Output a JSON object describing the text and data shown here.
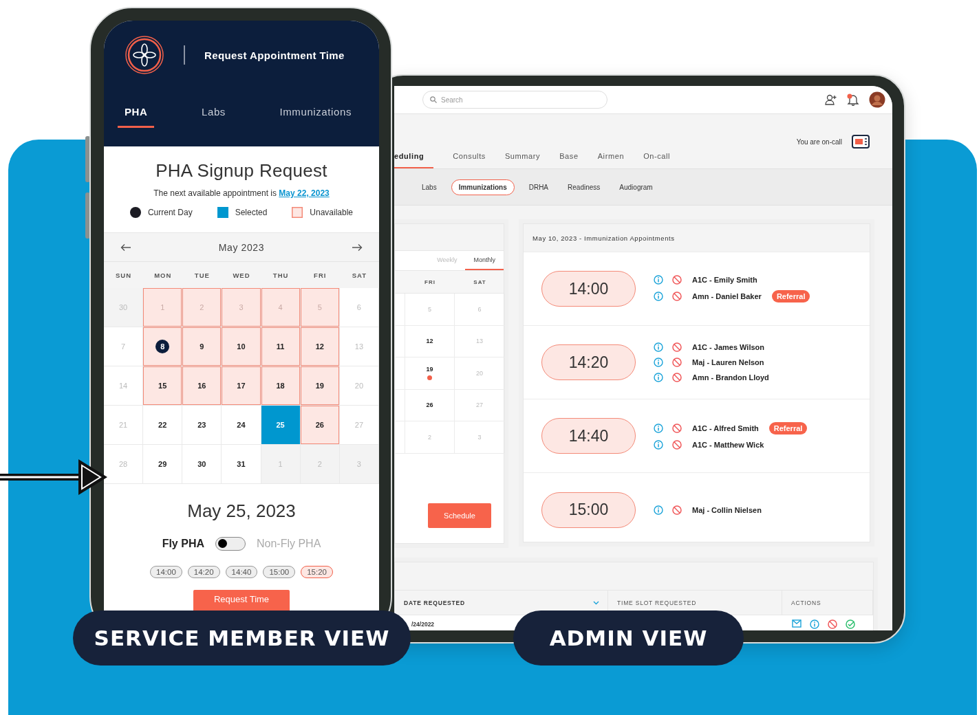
{
  "phone": {
    "title": "Request Appointment Time",
    "tabs": [
      {
        "label": "PHA",
        "selected": true
      },
      {
        "label": "Labs",
        "selected": false
      },
      {
        "label": "Immunizations",
        "selected": false
      }
    ],
    "heading": "PHA Signup Request",
    "next_available": {
      "text": "The next available appointment is",
      "link": "May 22, 2023"
    },
    "legend": [
      {
        "label": "Current Day",
        "kind": "current"
      },
      {
        "label": "Selected",
        "kind": "selected"
      },
      {
        "label": "Unavailable",
        "kind": "unavailable"
      }
    ],
    "calendar": {
      "month": "May 2023",
      "weekdays": [
        "SUN",
        "MON",
        "TUE",
        "WED",
        "THU",
        "FRI",
        "SAT"
      ],
      "weeks": [
        [
          {
            "day": "30",
            "kind": "outside"
          },
          {
            "day": "1",
            "kind": "past"
          },
          {
            "day": "2",
            "kind": "past"
          },
          {
            "day": "3",
            "kind": "past"
          },
          {
            "day": "4",
            "kind": "past"
          },
          {
            "day": "5",
            "kind": "past"
          },
          {
            "day": "6",
            "kind": "off"
          }
        ],
        [
          {
            "day": "7",
            "kind": "off"
          },
          {
            "day": "8",
            "kind": "today"
          },
          {
            "day": "9",
            "kind": "blocked"
          },
          {
            "day": "10",
            "kind": "blocked"
          },
          {
            "day": "11",
            "kind": "blocked"
          },
          {
            "day": "12",
            "kind": "blocked"
          },
          {
            "day": "13",
            "kind": "off"
          }
        ],
        [
          {
            "day": "14",
            "kind": "off"
          },
          {
            "day": "15",
            "kind": "blocked"
          },
          {
            "day": "16",
            "kind": "blocked"
          },
          {
            "day": "17",
            "kind": "blocked"
          },
          {
            "day": "18",
            "kind": "blocked"
          },
          {
            "day": "19",
            "kind": "blocked"
          },
          {
            "day": "20",
            "kind": "off"
          }
        ],
        [
          {
            "day": "21",
            "kind": "off"
          },
          {
            "day": "22",
            "kind": "open"
          },
          {
            "day": "23",
            "kind": "open"
          },
          {
            "day": "24",
            "kind": "open"
          },
          {
            "day": "25",
            "kind": "selected"
          },
          {
            "day": "26",
            "kind": "blocked"
          },
          {
            "day": "27",
            "kind": "off"
          }
        ],
        [
          {
            "day": "28",
            "kind": "off"
          },
          {
            "day": "29",
            "kind": "open"
          },
          {
            "day": "30",
            "kind": "open"
          },
          {
            "day": "31",
            "kind": "open"
          },
          {
            "day": "1",
            "kind": "outside"
          },
          {
            "day": "2",
            "kind": "outside"
          },
          {
            "day": "3",
            "kind": "outside"
          }
        ]
      ]
    },
    "selected_date": "May 25, 2023",
    "toggle": {
      "left_label": "Fly PHA",
      "right_label": "Non-Fly PHA",
      "on": false
    },
    "time_slots": [
      {
        "label": "14:00",
        "selected": false
      },
      {
        "label": "14:20",
        "selected": false
      },
      {
        "label": "14:40",
        "selected": false
      },
      {
        "label": "15:00",
        "selected": false
      },
      {
        "label": "15:20",
        "selected": true
      }
    ],
    "button": "Request Time"
  },
  "admin": {
    "search": {
      "placeholder": "Search"
    },
    "on_call": "You are on-call",
    "tabs": [
      {
        "label": "eduling",
        "selected": true
      },
      {
        "label": "Consults",
        "selected": false
      },
      {
        "label": "Summary",
        "selected": false
      },
      {
        "label": "Base",
        "selected": false
      },
      {
        "label": "Airmen",
        "selected": false
      },
      {
        "label": "On-call",
        "selected": false
      }
    ],
    "sub_tabs": [
      {
        "label": "Labs",
        "selected": false
      },
      {
        "label": "Immunizations",
        "selected": true
      },
      {
        "label": "DRHA",
        "selected": false
      },
      {
        "label": "Readiness",
        "selected": false
      },
      {
        "label": "Audiogram",
        "selected": false
      }
    ],
    "calendar": {
      "views": [
        {
          "label": "Weekly",
          "selected": false
        },
        {
          "label": "Monthly",
          "selected": true
        }
      ],
      "weekdays": [
        "FRI",
        "SAT"
      ],
      "weeks": [
        [
          {
            "day": "5",
            "kind": "muted"
          },
          {
            "day": "6",
            "kind": "muted"
          }
        ],
        [
          {
            "day": "12",
            "kind": "open"
          },
          {
            "day": "13",
            "kind": "muted"
          }
        ],
        [
          {
            "day": "19",
            "kind": "event"
          },
          {
            "day": "20",
            "kind": "muted"
          }
        ],
        [
          {
            "day": "26",
            "kind": "open"
          },
          {
            "day": "27",
            "kind": "muted"
          }
        ],
        [
          {
            "day": "2",
            "kind": "muted"
          },
          {
            "day": "3",
            "kind": "muted"
          }
        ]
      ]
    },
    "schedule_button": "Schedule",
    "appointments": {
      "title": "May 10, 2023 - Immunization Appointments",
      "slots": [
        {
          "time": "14:00",
          "people": [
            {
              "name": "A1C - Emily Smith"
            },
            {
              "name": "Amn - Daniel Baker",
              "badge": "Referral"
            }
          ]
        },
        {
          "time": "14:20",
          "people": [
            {
              "name": "A1C - James Wilson"
            },
            {
              "name": "Maj - Lauren Nelson"
            },
            {
              "name": "Amn - Brandon Lloyd"
            }
          ]
        },
        {
          "time": "14:40",
          "people": [
            {
              "name": "A1C - Alfred Smith",
              "badge": "Referral"
            },
            {
              "name": "A1C - Matthew Wick"
            }
          ]
        },
        {
          "time": "15:00",
          "people": [
            {
              "name": "Maj - Collin Nielsen"
            }
          ]
        }
      ]
    },
    "requests": {
      "columns": [
        {
          "label": "DATE REQUESTED",
          "sorted": true
        },
        {
          "label": "TIME SLOT REQUESTED",
          "sorted": false
        },
        {
          "label": "ACTIONS",
          "sorted": false
        }
      ],
      "rows": [
        {
          "date": "/24/2022"
        }
      ]
    }
  },
  "labels": [
    "SERVICE MEMBER VIEW",
    "ADMIN VIEW"
  ]
}
